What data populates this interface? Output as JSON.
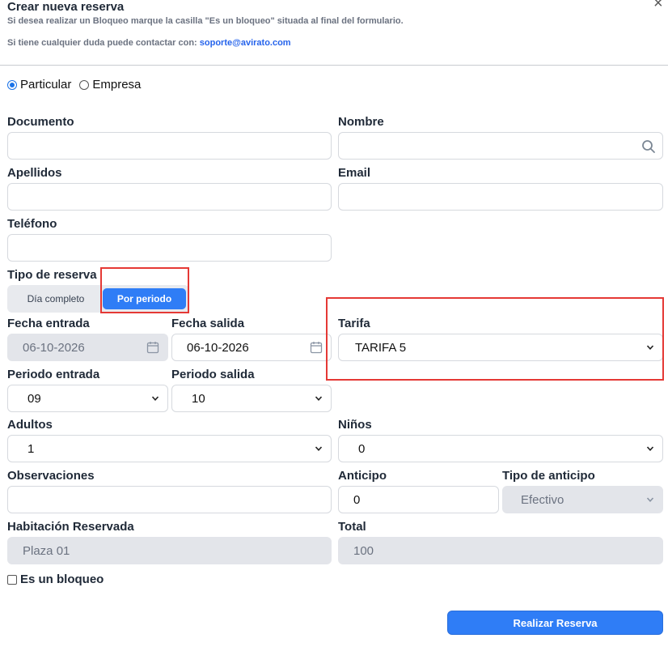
{
  "header": {
    "title": "Crear nueva reserva",
    "close_glyph": "×",
    "info_line": "Si desea realizar un Bloqueo marque la casilla \"Es un bloqueo\" situada al final del formulario.",
    "contact_prefix": "Si tiene cualquier duda puede contactar con:",
    "contact_email": "soporte@avirato.com"
  },
  "client_type": {
    "options": [
      "Particular",
      "Empresa"
    ],
    "selected": "Particular"
  },
  "fields": {
    "documento": {
      "label": "Documento",
      "value": ""
    },
    "nombre": {
      "label": "Nombre",
      "value": "",
      "icon": "search-icon"
    },
    "apellidos": {
      "label": "Apellidos",
      "value": ""
    },
    "email": {
      "label": "Email",
      "value": ""
    },
    "telefono": {
      "label": "Teléfono",
      "value": ""
    },
    "tipo_reserva": {
      "label": "Tipo de reserva",
      "options": [
        "Día completo",
        "Por periodo"
      ],
      "selected": "Por periodo"
    },
    "fecha_entrada": {
      "label": "Fecha entrada",
      "value": "06-10-2026",
      "icon": "calendar-icon",
      "disabled": true
    },
    "fecha_salida": {
      "label": "Fecha salida",
      "value": "06-10-2026",
      "icon": "calendar-icon"
    },
    "tarifa": {
      "label": "Tarifa",
      "value": "TARIFA 5"
    },
    "periodo_entrada": {
      "label": "Periodo entrada",
      "value": "09"
    },
    "periodo_salida": {
      "label": "Periodo salida",
      "value": "10"
    },
    "adultos": {
      "label": "Adultos",
      "value": "1"
    },
    "ninos": {
      "label": "Niños",
      "value": "0"
    },
    "observaciones": {
      "label": "Observaciones",
      "value": ""
    },
    "anticipo": {
      "label": "Anticipo",
      "value": "0"
    },
    "tipo_anticipo": {
      "label": "Tipo de anticipo",
      "value": "Efectivo",
      "disabled": true
    },
    "habitacion": {
      "label": "Habitación Reservada",
      "value": "Plaza 01",
      "disabled": true
    },
    "total": {
      "label": "Total",
      "value": "100",
      "disabled": true
    }
  },
  "bloqueo": {
    "label": "Es un bloqueo",
    "checked": false
  },
  "submit": {
    "label": "Realizar Reserva"
  },
  "colors": {
    "accent": "#2f7df6",
    "highlight": "#e53935",
    "disabled_bg": "#e3e5ea"
  }
}
